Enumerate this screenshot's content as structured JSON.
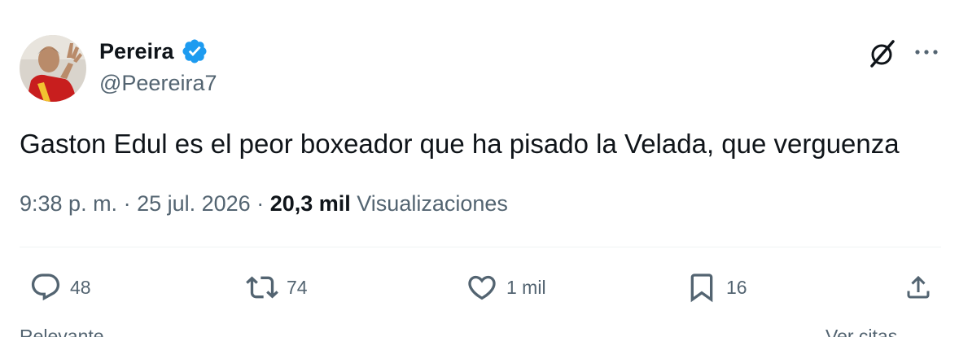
{
  "author": {
    "name": "Pereira",
    "handle": "@Peereira7",
    "verified": true
  },
  "icons": {
    "verified": "verified-badge-icon",
    "grok": "grok-icon",
    "more": "more-icon",
    "reply": "reply-icon",
    "retweet": "retweet-icon",
    "like": "heart-icon",
    "bookmark": "bookmark-icon",
    "share": "share-icon"
  },
  "tweet": {
    "text": "Gaston Edul es el peor boxeador que ha pisado la Velada, que verguenza",
    "time": "9:38 p. m.",
    "separator": " · ",
    "date": "25 jul. 2026",
    "views_count": "20,3 mil",
    "views_label": "Visualizaciones"
  },
  "actions": {
    "replies": "48",
    "retweets": "74",
    "likes": "1 mil",
    "bookmarks": "16"
  },
  "footer": {
    "relevant": "Relevante",
    "quotes": "Ver citas"
  },
  "colors": {
    "text": "#0f1419",
    "secondary": "#536471",
    "verified": "#1d9bf0",
    "divider": "#eff3f4"
  }
}
